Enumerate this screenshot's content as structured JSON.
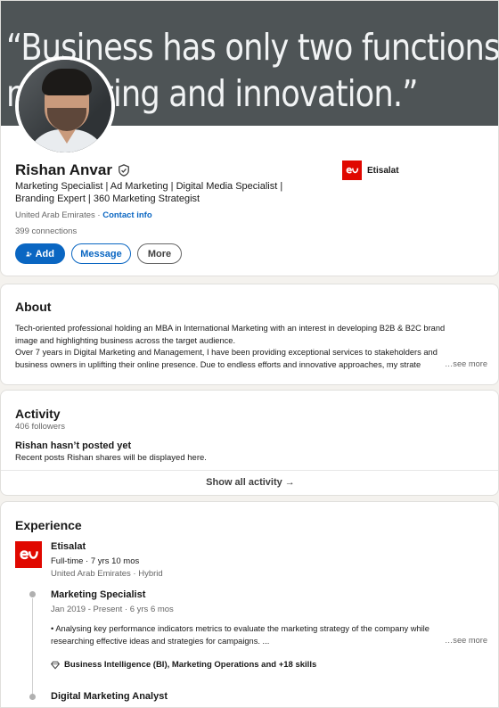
{
  "banner": {
    "line1": "“Business has only two functions—",
    "line2": "marketing and innovation.”"
  },
  "profile": {
    "name": "Rishan Anvar",
    "headline_line1": "Marketing Specialist | Ad Marketing | Digital Media Specialist |",
    "headline_line2": "Branding Expert | 360 Marketing Strategist",
    "location": "United Arab Emirates · ",
    "contact_label": "Contact info",
    "connections": "399 connections",
    "current_company": "Etisalat"
  },
  "actions": {
    "add": "Add",
    "message": "Message",
    "more": "More"
  },
  "about": {
    "title": "About",
    "line1": "Tech-oriented professional holding an MBA in International Marketing with an interest in developing B2B & B2C brand",
    "line2": "image and highlighting business across the target audience.",
    "line3": "Over 7 years in Digital Marketing and Management, I have been providing exceptional services to stakeholders and",
    "line4": "business owners in uplifting their online presence. Due to endless efforts and innovative approaches, my strate",
    "see_more": "…see more"
  },
  "activity": {
    "title": "Activity",
    "followers": "406 followers",
    "empty_title": "Rishan hasn’t posted yet",
    "empty_sub": "Recent posts Rishan shares will be displayed here.",
    "show_all": "Show all activity →"
  },
  "experience": {
    "title": "Experience",
    "company": "Etisalat",
    "employment": "Full-time · 7 yrs 10 mos",
    "company_location": "United Arab Emirates · Hybrid",
    "roles": [
      {
        "title": "Marketing Specialist",
        "dates": "Jan 2019 - Present · 6 yrs 6 mos",
        "desc_line1": "• Analysing key performance indicators metrics to evaluate the marketing strategy of the company while",
        "desc_line2": "researching effective ideas and strategies for campaigns. ...",
        "see_more": "…see more",
        "skills": "Business Intelligence (BI), Marketing Operations and +18 skills"
      },
      {
        "title": "Digital Marketing Analyst"
      }
    ]
  },
  "colors": {
    "brand_blue": "#0a66c2",
    "etisalat_red": "#e00800",
    "banner_bg": "#4e5456"
  }
}
